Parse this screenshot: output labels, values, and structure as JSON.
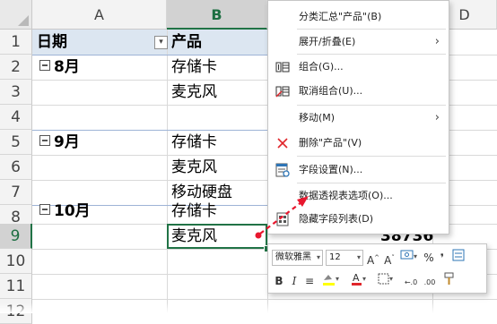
{
  "columns": [
    "A",
    "B",
    "D"
  ],
  "rows": [
    "1",
    "2",
    "3",
    "4",
    "5",
    "6",
    "7",
    "8",
    "9",
    "10",
    "11",
    "12"
  ],
  "pivot": {
    "header_date": "日期",
    "header_product": "产品",
    "groups": [
      {
        "label": "8月",
        "items": [
          "存储卡",
          "麦克风"
        ]
      },
      {
        "label": "9月",
        "items": [
          "存储卡",
          "麦克风",
          "移动硬盘"
        ]
      },
      {
        "label": "10月",
        "items": [
          "存储卡",
          "麦克风"
        ]
      }
    ],
    "visible_value": "38736"
  },
  "context_menu": {
    "items": [
      {
        "label": "分类汇总\"产品\"(B)",
        "icon": "none"
      },
      {
        "label": "展开/折叠(E)",
        "icon": "none",
        "submenu": true
      },
      {
        "label": "组合(G)...",
        "icon": "group-icon"
      },
      {
        "label": "取消组合(U)...",
        "icon": "ungroup-icon"
      },
      {
        "label": "移动(M)",
        "icon": "none",
        "submenu": true
      },
      {
        "label": "删除\"产品\"(V)",
        "icon": "delete-x-icon"
      },
      {
        "label": "字段设置(N)...",
        "icon": "field-settings-icon"
      },
      {
        "label": "数据透视表选项(O)...",
        "icon": "none"
      },
      {
        "label": "隐藏字段列表(D)",
        "icon": "field-list-icon"
      }
    ]
  },
  "mini_toolbar": {
    "font_name": "微软雅黑",
    "font_size": "12",
    "row1": [
      "A^",
      "A˅",
      "%",
      "9"
    ],
    "row2": [
      "B",
      "I",
      "≡"
    ]
  },
  "colors": {
    "selection_green": "#217346",
    "pivot_header_blue": "#dce6f1",
    "arrow_red": "#e8172e"
  }
}
